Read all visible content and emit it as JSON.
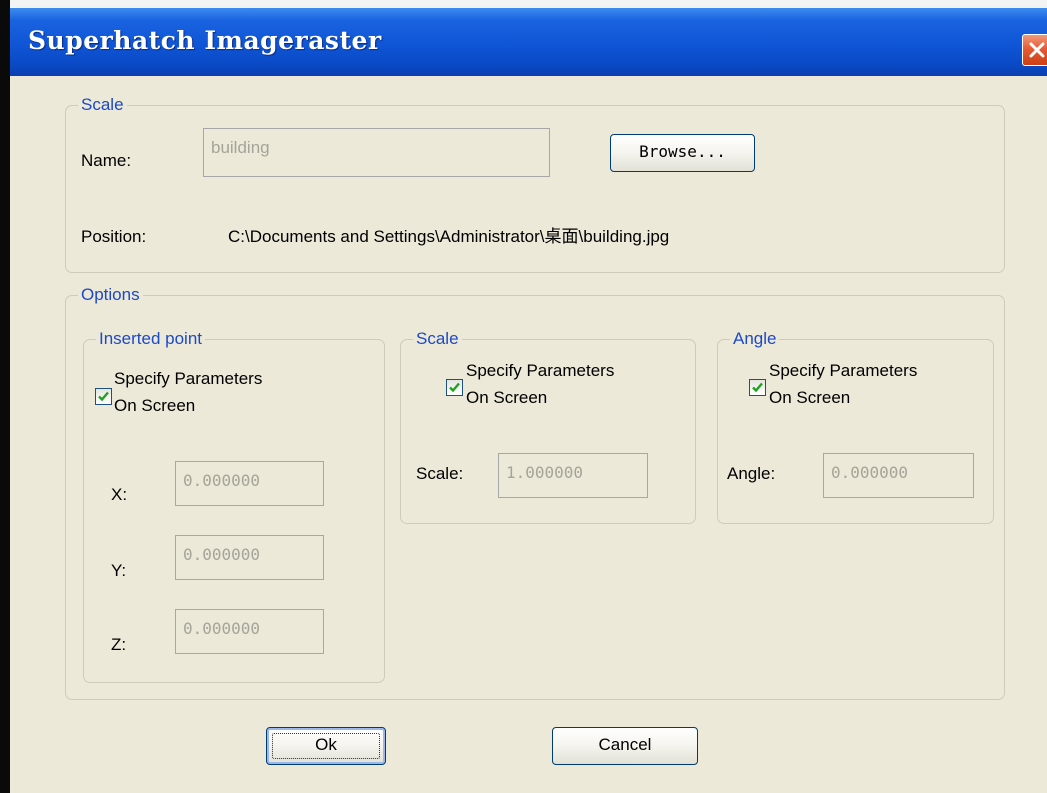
{
  "window": {
    "title": "Superhatch Imageraster",
    "close_glyph": "✕"
  },
  "file_group": {
    "legend": "Scale",
    "name_label": "Name:",
    "name_value": "building",
    "browse_label": "Browse...",
    "position_label": "Position:",
    "position_value": "C:\\Documents and Settings\\Administrator\\桌面\\building.jpg"
  },
  "options": {
    "legend": "Options",
    "inserted_point": {
      "legend": "Inserted point",
      "checkbox_line1": "Specify Parameters",
      "checkbox_line2": "On Screen",
      "checked": true,
      "x_label": "X:",
      "x_value": "0.000000",
      "y_label": "Y:",
      "y_value": "0.000000",
      "z_label": "Z:",
      "z_value": "0.000000"
    },
    "scale": {
      "legend": "Scale",
      "checkbox_line1": "Specify Parameters",
      "checkbox_line2": "On Screen",
      "checked": true,
      "scale_label": "Scale:",
      "scale_value": "1.000000"
    },
    "angle": {
      "legend": "Angle",
      "checkbox_line1": "Specify Parameters",
      "checkbox_line2": "On Screen",
      "checked": true,
      "angle_label": "Angle:",
      "angle_value": "0.000000"
    }
  },
  "buttons": {
    "ok_label": "Ok",
    "cancel_label": "Cancel"
  },
  "colors": {
    "titlebar": "#0f55d6",
    "dialog_bg": "#ece9d8",
    "group_label": "#1c49c8",
    "close_button": "#e55d35",
    "checkmark": "#21a121"
  },
  "icons": {
    "close": "close-icon",
    "check": "checkmark-icon"
  }
}
